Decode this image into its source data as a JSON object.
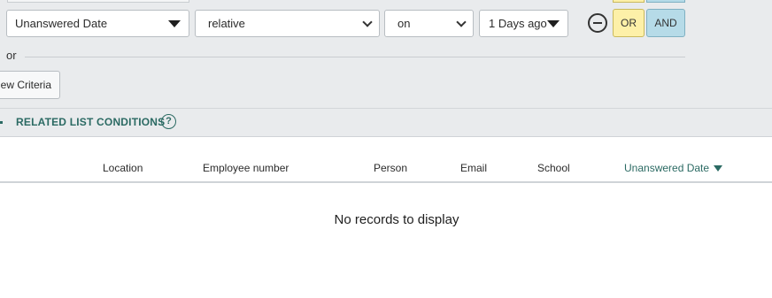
{
  "filter": {
    "field": "Unanswered Date",
    "mode": "relative",
    "operator": "on",
    "value": "1 Days ago",
    "or_label": "OR",
    "and_label": "AND",
    "or_separator": "or",
    "new_criteria_label": "New Criteria"
  },
  "related": {
    "label": "RELATED LIST CONDITIONS",
    "help_glyph": "?"
  },
  "table": {
    "columns": [
      "Location",
      "Employee number",
      "Person",
      "Email",
      "School",
      "Unanswered Date"
    ],
    "sorted_column": "Unanswered Date",
    "empty_message": "No records to display"
  }
}
